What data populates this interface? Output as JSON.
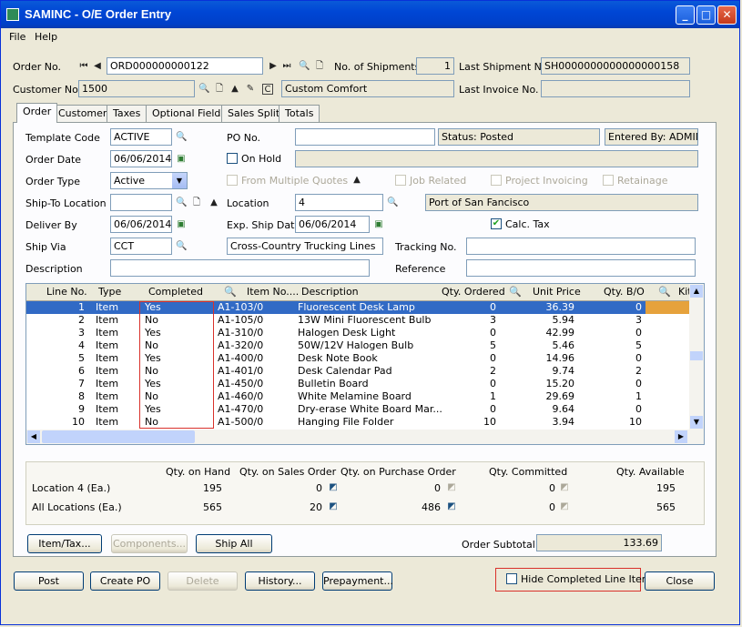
{
  "window": {
    "title": "SAMINC - O/E Order Entry"
  },
  "menu": {
    "file": "File",
    "help": "Help"
  },
  "header": {
    "order_no_label": "Order No.",
    "order_no": "ORD000000000122",
    "num_shipments_label": "No. of Shipments",
    "num_shipments": "1",
    "last_shipment_label": "Last Shipment No.",
    "last_shipment": "SH0000000000000000158",
    "customer_no_label": "Customer No.",
    "customer_no": "1500",
    "customer_name": "Custom Comfort",
    "last_invoice_label": "Last Invoice No.",
    "last_invoice": ""
  },
  "tabs": [
    "Order",
    "Customer",
    "Taxes",
    "Optional Fields",
    "Sales Split",
    "Totals"
  ],
  "order": {
    "template_code_label": "Template Code",
    "template_code": "ACTIVE",
    "po_no_label": "PO No.",
    "po_no": "",
    "status": "Status: Posted",
    "entered_by": "Entered By: ADMIN",
    "order_date_label": "Order Date",
    "order_date": "06/06/2014",
    "on_hold_label": "On Hold",
    "order_type_label": "Order Type",
    "order_type": "Active",
    "from_multiple_quotes_label": "From Multiple Quotes",
    "job_related_label": "Job Related",
    "project_invoicing_label": "Project Invoicing",
    "retainage_label": "Retainage",
    "ship_to_label": "Ship-To Location",
    "ship_to": "",
    "location_label": "Location",
    "location": "4",
    "location_name": "Port of San Fancisco",
    "deliver_by_label": "Deliver By",
    "deliver_by": "06/06/2014",
    "exp_ship_date_label": "Exp. Ship Date",
    "exp_ship_date": "06/06/2014",
    "calc_tax_label": "Calc. Tax",
    "ship_via_label": "Ship Via",
    "ship_via": "CCT",
    "ship_via_name": "Cross-Country Trucking Lines",
    "tracking_label": "Tracking No.",
    "tracking": "",
    "description_label": "Description",
    "description": "",
    "reference_label": "Reference",
    "reference": ""
  },
  "grid": {
    "headers": {
      "line_no": "Line No.",
      "type": "Type",
      "completed": "Completed",
      "item_no": "Item No....",
      "description": "Description",
      "qty_ordered": "Qty. Ordered",
      "unit_price": "Unit Price",
      "qty_bo": "Qty. B/O",
      "kit": "Kit"
    },
    "rows": [
      {
        "line": "1",
        "type": "Item",
        "completed": "Yes",
        "item": "A1-103/0",
        "desc": "Fluorescent Desk Lamp",
        "qty": "0",
        "price": "36.39",
        "bo": "0"
      },
      {
        "line": "2",
        "type": "Item",
        "completed": "No",
        "item": "A1-105/0",
        "desc": "13W Mini Fluorescent Bulb",
        "qty": "3",
        "price": "5.94",
        "bo": "3"
      },
      {
        "line": "3",
        "type": "Item",
        "completed": "Yes",
        "item": "A1-310/0",
        "desc": "Halogen Desk Light",
        "qty": "0",
        "price": "42.99",
        "bo": "0"
      },
      {
        "line": "4",
        "type": "Item",
        "completed": "No",
        "item": "A1-320/0",
        "desc": "50W/12V Halogen Bulb",
        "qty": "5",
        "price": "5.46",
        "bo": "5"
      },
      {
        "line": "5",
        "type": "Item",
        "completed": "Yes",
        "item": "A1-400/0",
        "desc": "Desk Note Book",
        "qty": "0",
        "price": "14.96",
        "bo": "0"
      },
      {
        "line": "6",
        "type": "Item",
        "completed": "No",
        "item": "A1-401/0",
        "desc": "Desk Calendar Pad",
        "qty": "2",
        "price": "9.74",
        "bo": "2"
      },
      {
        "line": "7",
        "type": "Item",
        "completed": "Yes",
        "item": "A1-450/0",
        "desc": "Bulletin Board",
        "qty": "0",
        "price": "15.20",
        "bo": "0"
      },
      {
        "line": "8",
        "type": "Item",
        "completed": "No",
        "item": "A1-460/0",
        "desc": "White Melamine Board",
        "qty": "1",
        "price": "29.69",
        "bo": "1"
      },
      {
        "line": "9",
        "type": "Item",
        "completed": "Yes",
        "item": "A1-470/0",
        "desc": "Dry-erase White Board Mar...",
        "qty": "0",
        "price": "9.64",
        "bo": "0"
      },
      {
        "line": "10",
        "type": "Item",
        "completed": "No",
        "item": "A1-500/0",
        "desc": "Hanging File Folder",
        "qty": "10",
        "price": "3.94",
        "bo": "10"
      }
    ]
  },
  "summary": {
    "col_on_hand": "Qty. on Hand",
    "col_on_so": "Qty. on Sales Order",
    "col_on_po": "Qty. on Purchase Order",
    "col_committed": "Qty. Committed",
    "col_available": "Qty. Available",
    "row1_label": "Location  4 (Ea.)",
    "row1": {
      "on_hand": "195",
      "on_so": "0",
      "on_po": "0",
      "committed": "0",
      "available": "195"
    },
    "row2_label": "All Locations (Ea.)",
    "row2": {
      "on_hand": "565",
      "on_so": "20",
      "on_po": "486",
      "committed": "0",
      "available": "565"
    }
  },
  "actions": {
    "item_tax": "Item/Tax...",
    "components": "Components...",
    "ship_all": "Ship All",
    "order_subtotal_label": "Order Subtotal",
    "order_subtotal": "133.69"
  },
  "footer": {
    "post": "Post",
    "create_po": "Create PO",
    "delete": "Delete",
    "history": "History...",
    "prepayment": "Prepayment...",
    "hide_completed": "Hide Completed Line Items",
    "close": "Close"
  },
  "colors": {
    "selection": "#316ac5",
    "highlight_box": "#d9312b",
    "kit_cell": "#e6a23c"
  }
}
